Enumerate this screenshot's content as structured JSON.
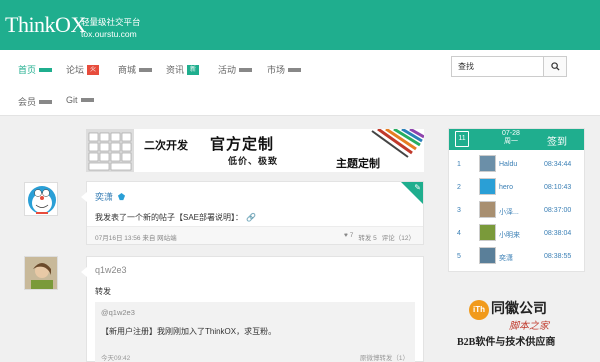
{
  "header": {
    "logo": "ThinkOX",
    "tagline": "轻量级社交平台",
    "domain": "tox.ourstu.com",
    "brand_color": "#1fae8e"
  },
  "nav": {
    "items": [
      {
        "label": "首页",
        "active": true
      },
      {
        "label": "论坛",
        "badge": "火",
        "badge_color": "#e74c3c"
      },
      {
        "label": "商城"
      },
      {
        "label": "资讯",
        "badge": "新",
        "badge_color": "#1fae8e"
      },
      {
        "label": "活动"
      },
      {
        "label": "市场"
      },
      {
        "label": "会员"
      },
      {
        "label": "Git"
      }
    ]
  },
  "search": {
    "value": "查找",
    "icon": "search-icon"
  },
  "banner": {
    "text1": "二次开发",
    "text2": "官方定制",
    "text3": "低价、极致",
    "text4": "主题定制"
  },
  "feed": [
    {
      "author": "奕潇",
      "content": "我发表了一个新的帖子【SAE部署说明】：",
      "time": "07月16日 13:56",
      "source": "来自 网站端",
      "likes": "7",
      "repost": "转发 5",
      "comments": "评论（12）"
    },
    {
      "author": "q1w2e3",
      "content": "转发",
      "quote_author": "@q1w2e3",
      "quote_content": "【新用户注册】我刚刚加入了ThinkOX，求互粉。",
      "quote_time": "今天09:42",
      "quote_meta": "原微博转发（1）"
    }
  ],
  "checkin": {
    "cal_day": "11",
    "date_line1": "07-28",
    "date_line2": "周一",
    "sign_label": "签到",
    "rows": [
      {
        "rank": "1",
        "name": "Haldu",
        "time": "08:34:44"
      },
      {
        "rank": "2",
        "name": "hero",
        "time": "08:10:43"
      },
      {
        "rank": "3",
        "name": "小泽...",
        "time": "08:37:00"
      },
      {
        "rank": "4",
        "name": "小明来",
        "time": "08:38:04"
      },
      {
        "rank": "5",
        "name": "奕潇",
        "time": "08:38:55"
      }
    ]
  },
  "watermark": {
    "logo": "iTh",
    "title": "同徽公司",
    "subtitle": "脚本之家",
    "slogan": "B2B软件与技术供应商"
  }
}
